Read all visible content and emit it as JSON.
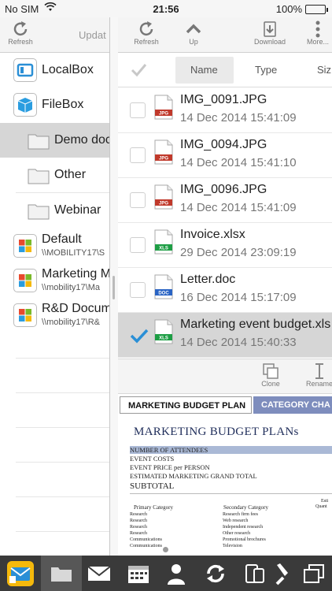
{
  "status": {
    "carrier": "No SIM",
    "time": "21:56",
    "battery": "100%"
  },
  "left_toolbar": {
    "refresh_label": "Refresh",
    "update_label": "Updat"
  },
  "right_toolbar": {
    "refresh_label": "Refresh",
    "up_label": "Up",
    "download_label": "Download",
    "more_label": "More..."
  },
  "tree": [
    {
      "label": "LocalBox"
    },
    {
      "label": "FileBox"
    },
    {
      "label": "Demo doc"
    },
    {
      "label": "Other"
    },
    {
      "label": "Webinar"
    },
    {
      "label": "Default",
      "sub": "\\\\MOBILITY17\\S"
    },
    {
      "label": "Marketing M",
      "sub": "\\\\mobility17\\Ma"
    },
    {
      "label": "R&D Docum",
      "sub": "\\\\mobility17\\R&"
    }
  ],
  "columns": {
    "name": "Name",
    "type": "Type",
    "size": "Siz"
  },
  "files": [
    {
      "name": "IMG_0091.JPG",
      "date": "14 Dec 2014 15:41:09",
      "badge": "JPG",
      "color": "#c0392b"
    },
    {
      "name": "IMG_0094.JPG",
      "date": "14 Dec 2014 15:41:10",
      "badge": "JPG",
      "color": "#c0392b"
    },
    {
      "name": "IMG_0096.JPG",
      "date": "14 Dec 2014 15:41:09",
      "badge": "JPG",
      "color": "#c0392b"
    },
    {
      "name": "Invoice.xlsx",
      "date": "29 Dec 2014 23:09:19",
      "badge": "XLS",
      "color": "#1e9e45"
    },
    {
      "name": "Letter.doc",
      "date": "16 Dec 2014 15:17:09",
      "badge": "DOC",
      "color": "#2a64c4"
    },
    {
      "name": "Marketing event budget.xls",
      "date": "14 Dec 2014 15:40:33",
      "badge": "XLS",
      "color": "#1e9e45"
    }
  ],
  "actions": {
    "clone_label": "Clone",
    "rename_label": "Rename"
  },
  "preview": {
    "tab_active": "MARKETING BUDGET PLAN",
    "tab_inactive": "CATEGORY CHA",
    "title": "MARKETING BUDGET PLANs",
    "lines": [
      "NUMBER OF ATTENDEES",
      "EVENT COSTS",
      "EVENT PRICE per PERSON",
      "ESTIMATED MARKETING GRAND TOTAL"
    ],
    "subtotal": "SUBTOTAL",
    "col_primary": "Primary Category",
    "col_secondary": "Secondary Category",
    "col_esti": "Esti",
    "col_quant": "Quant",
    "primary": [
      "Research",
      "Research",
      "Research",
      "Research",
      "Communications",
      "Communications"
    ],
    "secondary": [
      "Research firm fees",
      "Web research",
      "Independent research",
      "Other research",
      "Promotional brochures",
      "Television"
    ]
  },
  "colors": {
    "accent": "#2a8fd6",
    "tabbar": "#3a3a3a",
    "tab_inactive": "#7e8dbd"
  }
}
